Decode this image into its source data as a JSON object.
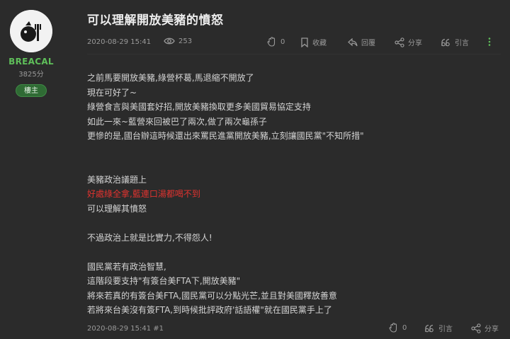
{
  "author": {
    "username": "BREACAL",
    "score": "3825分",
    "badge": "樓主"
  },
  "post": {
    "title": "可以理解開放美豬的憤怒",
    "date": "2020-08-29 15:41",
    "views": "253",
    "likes": "0",
    "bookmark_label": "收藏",
    "reply_label": "回覆",
    "share_label": "分享",
    "quote_label": "引言"
  },
  "content": {
    "lines": [
      {
        "text": "之前馬要開放美豬,綠營杯葛,馬退縮不開放了",
        "highlight": false
      },
      {
        "text": "現在可好了~",
        "highlight": false
      },
      {
        "text": "綠營食言與美國套好招,開放美豬換取更多美國貿易協定支持",
        "highlight": false
      },
      {
        "text": "如此一來~藍營來回被巴了兩次,做了兩次龜孫子",
        "highlight": false
      },
      {
        "text": "更慘的是,國台辦這時候還出來罵民進黨開放美豬,立刻讓國民黨\"不知所措\"",
        "highlight": false
      },
      {
        "text": "",
        "highlight": false
      },
      {
        "text": "",
        "highlight": false
      },
      {
        "text": "美豬政治議題上",
        "highlight": false
      },
      {
        "text": "好處綠全拿,藍連口湯都喝不到",
        "highlight": true
      },
      {
        "text": "可以理解其憤怒",
        "highlight": false
      },
      {
        "text": "",
        "highlight": false
      },
      {
        "text": "不過政治上就是比實力,不得怨人!",
        "highlight": false
      },
      {
        "text": "",
        "highlight": false
      },
      {
        "text": "國民黨若有政治智慧,",
        "highlight": false
      },
      {
        "text": "這階段要支持\"有簽台美FTA下,開放美豬\"",
        "highlight": false
      },
      {
        "text": "將來若真的有簽台美FTA,國民黨可以分點光芒,並且對美國釋放善意",
        "highlight": false
      },
      {
        "text": "若將來台美沒有簽FTA,到時候批評政府'話語權\"就在國民黨手上了",
        "highlight": false
      }
    ]
  },
  "footer": {
    "date_floor": "2020-08-29 15:41 #1",
    "likes": "0",
    "quote_label": "引言",
    "share_label": "分享"
  },
  "icons": {
    "views": "eye-icon",
    "like": "clap-icon",
    "bookmark": "bookmark-icon",
    "reply": "reply-icon",
    "share": "share-icon",
    "quote": "quote-icon",
    "more": "more-vertical-icon"
  },
  "colors": {
    "background": "#2b2b2b",
    "username": "#5fbf5a",
    "badge_bg": "#2f6b34",
    "highlight_text": "#e0332f"
  }
}
